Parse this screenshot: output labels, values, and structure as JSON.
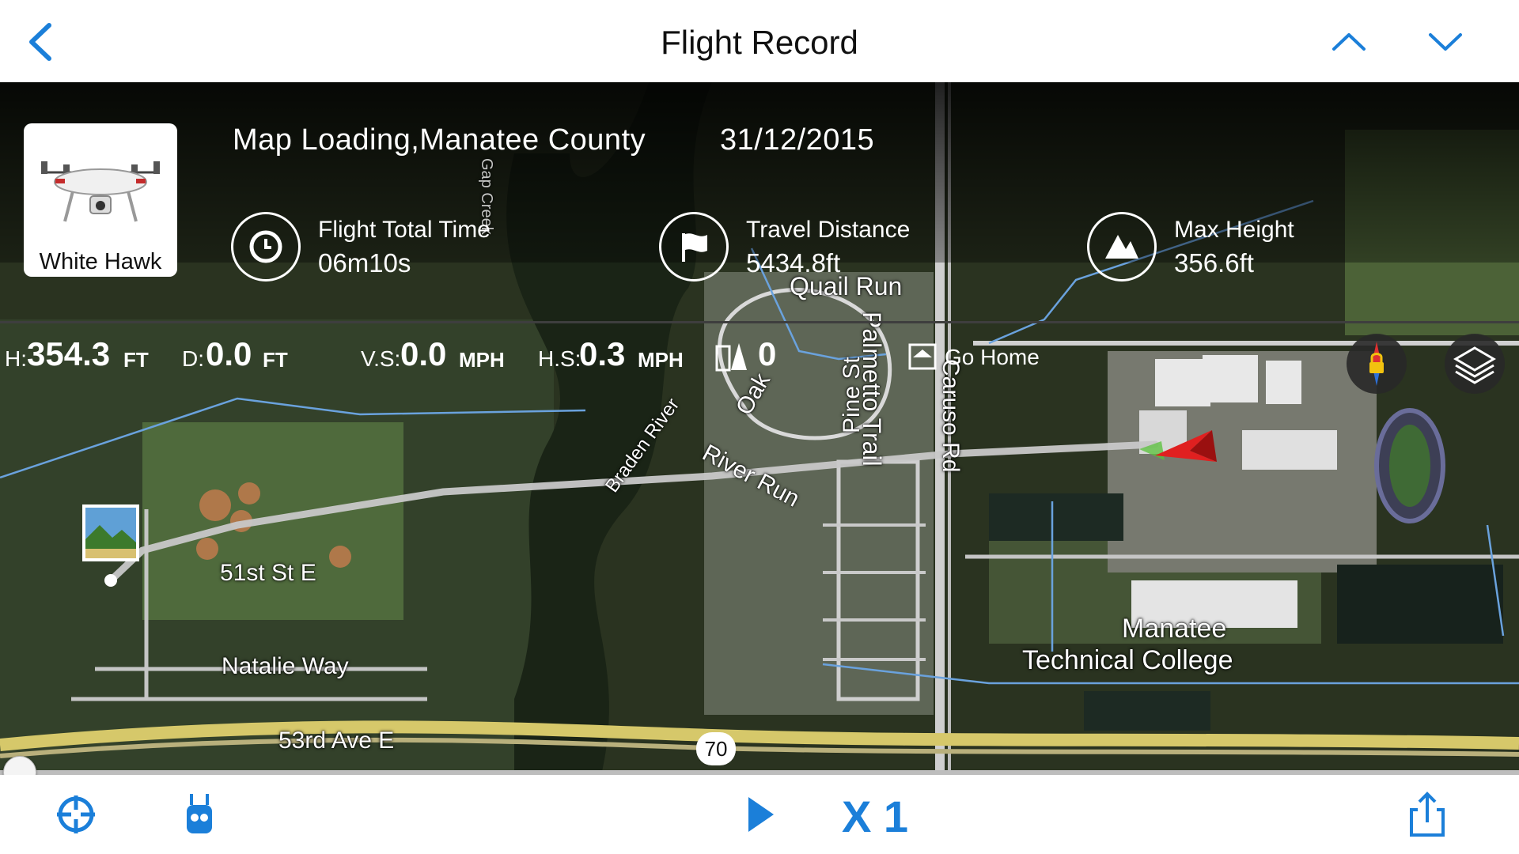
{
  "header": {
    "title": "Flight Record",
    "icons": [
      "back-chevron-icon",
      "chevron-up-icon",
      "chevron-down-icon"
    ]
  },
  "summary": {
    "aircraft_name": "White Hawk",
    "location": "Map Loading,Manatee County",
    "date": "31/12/2015",
    "stats": [
      {
        "label": "Flight Total Time",
        "value": "06m10s",
        "icon": "clock-icon"
      },
      {
        "label": "Travel Distance",
        "value": "5434.8ft",
        "icon": "flag-icon"
      },
      {
        "label": "Max Height",
        "value": "356.6ft",
        "icon": "mountain-icon"
      }
    ]
  },
  "telemetry": {
    "h_key": "H:",
    "h_val": "354.3",
    "h_unit": "FT",
    "d_key": "D:",
    "d_val": "0.0",
    "d_unit": "FT",
    "vs_key": "V.S:",
    "vs_val": "0.0",
    "vs_unit": "MPH",
    "hs_key": "H.S:",
    "hs_val": "0.3",
    "hs_unit": "MPH",
    "battery_val": "0",
    "go_home": "Go Home"
  },
  "map_labels": {
    "quail_run": "Quail Run",
    "river_run": "River Run",
    "oak": "Oak",
    "pine_st": "Pine St",
    "palmetto": "Palmetto Trail",
    "caruso": "Caruso Rd",
    "braden": "Braden River",
    "gap_creek": "Gap Creek",
    "st51": "51st St E",
    "natalie": "Natalie Way",
    "ave53": "53rd Ave E",
    "route70": "70",
    "manatee1": "Manatee",
    "manatee2": "Technical College"
  },
  "map_buttons": [
    "compass-lock-button",
    "map-layers-button"
  ],
  "playback": {
    "progress": 0.0,
    "speed_label": "X 1",
    "controls": [
      "recenter-icon",
      "remote-controller-icon",
      "play-icon",
      "share-icon"
    ]
  },
  "colors": {
    "accent": "#1b7fd9",
    "flight_path": "#c8c8c8",
    "aircraft_arrow": "#e02020"
  }
}
